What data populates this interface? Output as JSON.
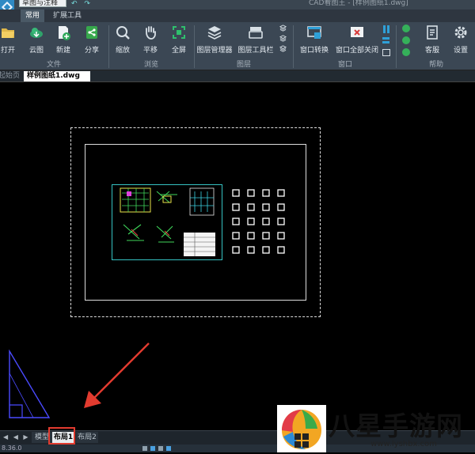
{
  "titlebar": {
    "workspace": "草图与注释",
    "window_title": "CAD看图王 - [样例图纸1.dwg]",
    "qa_icons": [
      "undo-icon",
      "redo-icon",
      "dropdown-icon"
    ]
  },
  "ribbon_tabs": [
    {
      "label": "常用",
      "active": true
    },
    {
      "label": "扩展工具",
      "active": false
    }
  ],
  "ribbon": {
    "buttons": [
      {
        "label": "打开",
        "icon": "folder-open-icon"
      },
      {
        "label": "云图",
        "icon": "cloud-icon"
      },
      {
        "label": "新建",
        "icon": "new-file-icon"
      },
      {
        "label": "分享",
        "icon": "share-icon"
      },
      {
        "label": "缩放",
        "icon": "zoom-icon"
      },
      {
        "label": "平移",
        "icon": "pan-hand-icon"
      },
      {
        "label": "全屏",
        "icon": "fullscreen-icon"
      },
      {
        "label": "图层管理器",
        "icon": "layer-manager-icon"
      },
      {
        "label": "图层工具栏",
        "icon": "layer-toolbar-icon"
      },
      {
        "label": "窗口转换",
        "icon": "window-switch-icon"
      },
      {
        "label": "窗口全部关闭",
        "icon": "close-all-windows-icon"
      },
      {
        "label": "客服",
        "icon": "customer-service-icon"
      },
      {
        "label": "设置",
        "icon": "settings-gear-icon"
      }
    ],
    "groups": [
      "文件",
      "浏览",
      "图层",
      "窗口",
      "帮助"
    ]
  },
  "document_tabs": [
    {
      "label": "起始页",
      "active": false
    },
    {
      "label": "样例图纸1.dwg",
      "active": true
    }
  ],
  "layout_tabs": [
    {
      "label": "模型",
      "active": false
    },
    {
      "label": "布局1",
      "active": true
    },
    {
      "label": "布局2",
      "active": false
    }
  ],
  "status": {
    "coords": "8.36.0"
  },
  "watermark": {
    "text": "八星手游网",
    "url": "www.lyshbx.com"
  },
  "colors": {
    "ribbon": "#3b4754",
    "canvas": "#000000",
    "viewport_border": "#35c2c2",
    "highlight": "#e23b2f",
    "arrow": "#e23b2f"
  }
}
